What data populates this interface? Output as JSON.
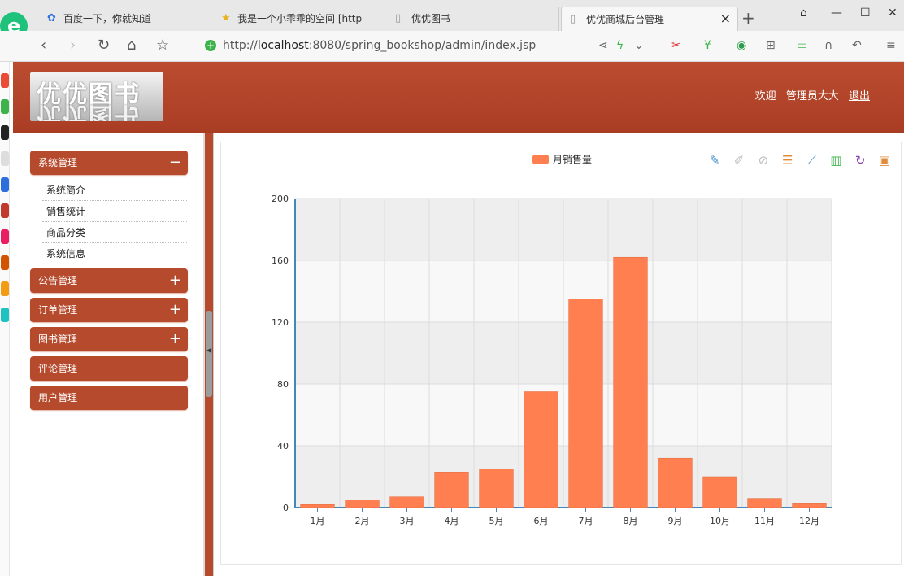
{
  "browser": {
    "tabs": [
      {
        "label": "百度一下，你就知道"
      },
      {
        "label": "我是一个小乖乖的空间 [http"
      },
      {
        "label": "优优图书"
      },
      {
        "label": "优优商城后台管理"
      }
    ],
    "url_prefix": "http://",
    "url_host": "localhost",
    "url_rest": ":8080/spring_bookshop/admin/index.jsp"
  },
  "header": {
    "logo_text": "优优图书",
    "welcome": "欢迎",
    "user": "管理员大大",
    "logout": "退出"
  },
  "sidebar": {
    "groups": [
      {
        "label": "系统管理",
        "toggle": "−",
        "items": [
          "系统简介",
          "销售统计",
          "商品分类",
          "系统信息"
        ]
      },
      {
        "label": "公告管理",
        "toggle": "+"
      },
      {
        "label": "订单管理",
        "toggle": "+"
      },
      {
        "label": "图书管理",
        "toggle": "+"
      },
      {
        "label": "评论管理",
        "toggle": ""
      },
      {
        "label": "用户管理",
        "toggle": ""
      }
    ]
  },
  "colors": {
    "brand": "#b64a2d",
    "bar": "#ff7f50"
  },
  "toolbox_icons": [
    "mark-icon",
    "mark-undo-icon",
    "mark-clear-icon",
    "data-view-icon",
    "line-chart-icon",
    "bar-chart-icon",
    "restore-icon",
    "save-image-icon"
  ],
  "chart_data": {
    "type": "bar",
    "legend": [
      "月销售量"
    ],
    "categories": [
      "1月",
      "2月",
      "3月",
      "4月",
      "5月",
      "6月",
      "7月",
      "8月",
      "9月",
      "10月",
      "11月",
      "12月"
    ],
    "series": [
      {
        "name": "月销售量",
        "values": [
          2,
          5,
          7,
          23,
          25,
          75,
          135,
          162,
          32,
          20,
          6,
          3
        ]
      }
    ],
    "ylim": [
      0,
      200
    ],
    "yticks": [
      0,
      40,
      80,
      120,
      160,
      200
    ],
    "grid": true,
    "legend_position": "top-center"
  }
}
